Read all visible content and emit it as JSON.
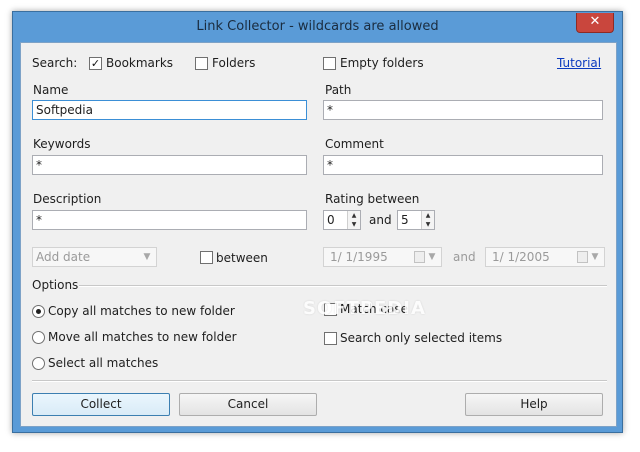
{
  "window": {
    "title": "Link Collector - wildcards are allowed",
    "close_label": "✕"
  },
  "search": {
    "label": "Search:",
    "bookmarks": {
      "label": "Bookmarks",
      "checked": true
    },
    "folders": {
      "label": "Folders",
      "checked": false
    },
    "empty_folders": {
      "label": "Empty folders",
      "checked": false
    },
    "tutorial_link": "Tutorial"
  },
  "fields": {
    "name": {
      "label": "Name",
      "value": "Softpedia"
    },
    "path": {
      "label": "Path",
      "value": "*"
    },
    "keywords": {
      "label": "Keywords",
      "value": "*"
    },
    "comment": {
      "label": "Comment",
      "value": "*"
    },
    "description": {
      "label": "Description",
      "value": "*"
    }
  },
  "rating": {
    "label": "Rating between",
    "from": "0",
    "and_label": "and",
    "to": "5"
  },
  "date": {
    "add_date_placeholder": "Add date",
    "between_label": "between",
    "from_date": "1/  1/1995",
    "and_label": "and",
    "to_date": "1/  1/2005"
  },
  "options": {
    "legend": "Options",
    "copy_label": "Copy all matches to new folder",
    "move_label": "Move all matches to new folder",
    "select_label": "Select all matches",
    "selected": "copy",
    "match_case": "Match case",
    "search_selected": "Search only selected items"
  },
  "buttons": {
    "collect": "Collect",
    "cancel": "Cancel",
    "help": "Help"
  },
  "watermark": "SOFTPEDIA"
}
